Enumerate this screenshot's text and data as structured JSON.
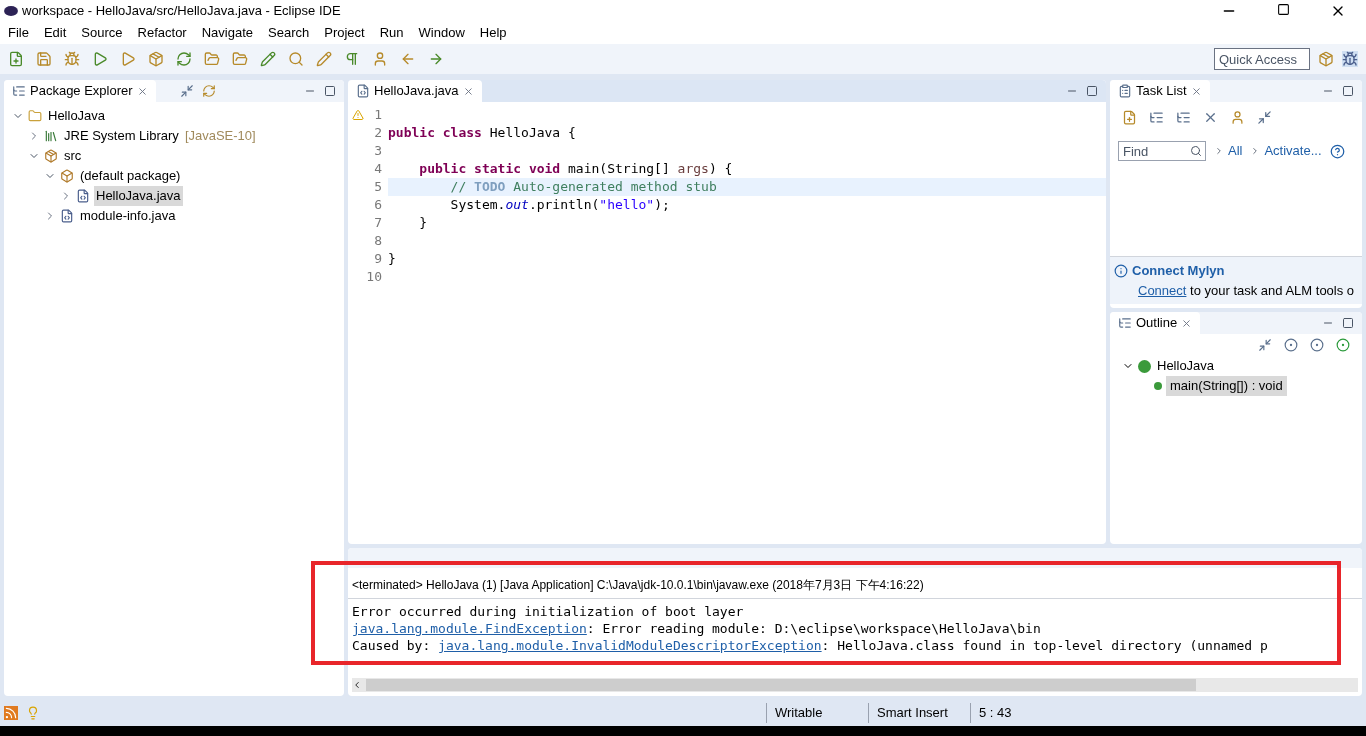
{
  "window": {
    "title": "workspace - HelloJava/src/HelloJava.java - Eclipse IDE"
  },
  "menu": [
    "File",
    "Edit",
    "Source",
    "Refactor",
    "Navigate",
    "Search",
    "Project",
    "Run",
    "Window",
    "Help"
  ],
  "quick_access": {
    "placeholder": "Quick Access"
  },
  "package_explorer": {
    "title": "Package Explorer",
    "tree": [
      {
        "label": "HelloJava",
        "kind": "project",
        "expanded": true,
        "selected": false,
        "children": [
          {
            "label": "JRE System Library",
            "suffix": "[JavaSE-10]",
            "kind": "library",
            "expanded": false,
            "selected": false
          },
          {
            "label": "src",
            "kind": "folder",
            "expanded": true,
            "selected": false,
            "children": [
              {
                "label": "(default package)",
                "kind": "package",
                "expanded": true,
                "selected": false,
                "children": [
                  {
                    "label": "HelloJava.java",
                    "kind": "file",
                    "expanded": false,
                    "selected": true
                  }
                ]
              },
              {
                "label": "module-info.java",
                "kind": "file",
                "expanded": false,
                "selected": false
              }
            ]
          }
        ]
      }
    ]
  },
  "editor": {
    "tab": "HelloJava.java",
    "lines": [
      {
        "number": "1",
        "current": false
      },
      {
        "number": "2",
        "current": false,
        "tokens": [
          {
            "kind": "keyword",
            "text": "public class"
          },
          {
            "kind": "plain",
            "text": " HelloJava {"
          }
        ]
      },
      {
        "number": "3",
        "current": false
      },
      {
        "number": "4",
        "current": false,
        "tokens": [
          {
            "kind": "keyword",
            "text": "    public static void"
          },
          {
            "kind": "plain",
            "text": " main(String[] "
          },
          {
            "kind": "param",
            "text": "args"
          },
          {
            "kind": "plain",
            "text": ") {"
          }
        ]
      },
      {
        "number": "5",
        "current": true,
        "tokens": [
          {
            "kind": "comment",
            "text": "        // "
          },
          {
            "kind": "todo",
            "text": "TODO"
          },
          {
            "kind": "comment",
            "text": " Auto-generated method stub"
          }
        ]
      },
      {
        "number": "6",
        "current": false,
        "tokens": [
          {
            "kind": "plain",
            "text": "        System."
          },
          {
            "kind": "field",
            "text": "out"
          },
          {
            "kind": "plain",
            "text": ".println("
          },
          {
            "kind": "string",
            "text": "\"hello\""
          },
          {
            "kind": "plain",
            "text": ");"
          }
        ]
      },
      {
        "number": "7",
        "current": false,
        "tokens": [
          {
            "kind": "plain",
            "text": "    }"
          }
        ]
      },
      {
        "number": "8",
        "current": false
      },
      {
        "number": "9",
        "current": false,
        "tokens": [
          {
            "kind": "plain",
            "text": "}"
          }
        ]
      },
      {
        "number": "10",
        "current": false
      }
    ]
  },
  "task_list": {
    "title": "Task List",
    "find": {
      "placeholder": "Find"
    },
    "links": [
      "All",
      "Activate..."
    ],
    "mylyn": {
      "title": "Connect Mylyn",
      "link": "Connect",
      "text": " to your task and ALM tools o"
    }
  },
  "outline": {
    "title": "Outline",
    "tree": [
      {
        "label": "HelloJava",
        "expanded": true,
        "selected": false,
        "children": [
          {
            "label": "main(String[]) : void",
            "selected": true
          }
        ]
      }
    ]
  },
  "console": {
    "header": "<terminated> HelloJava (1) [Java Application] C:\\Java\\jdk-10.0.1\\bin\\javaw.exe (2018年7月3日 下午4:16:22)",
    "lines": [
      [
        {
          "kind": "plain",
          "text": "Error occurred during initialization of boot layer"
        }
      ],
      [
        {
          "kind": "link",
          "text": "java.lang.module.FindException"
        },
        {
          "kind": "plain",
          "text": ": Error reading module: D:\\eclipse\\workspace\\HelloJava\\bin"
        }
      ],
      [
        {
          "kind": "plain",
          "text": "Caused by: "
        },
        {
          "kind": "link",
          "text": "java.lang.module.InvalidModuleDescriptorException"
        },
        {
          "kind": "plain",
          "text": ": HelloJava.class found in top-level directory (unnamed p"
        }
      ]
    ]
  },
  "status_bar": [
    "Writable",
    "Smart Insert",
    "5 : 43"
  ]
}
